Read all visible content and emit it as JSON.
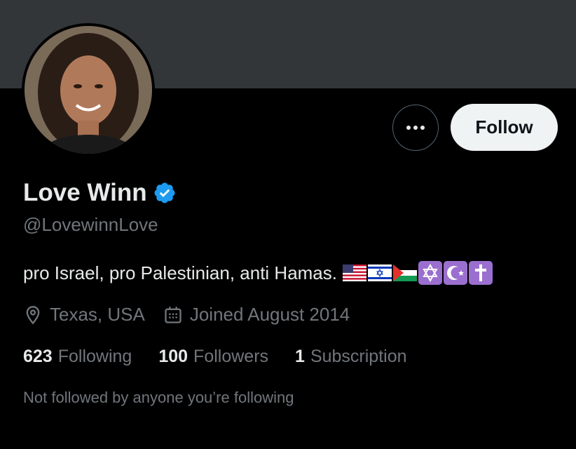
{
  "profile": {
    "display_name": "Love Winn",
    "handle": "@LovewinnLove",
    "bio": "pro Israel, pro Palestinian, anti Hamas.",
    "bio_emojis": [
      "us-flag-icon",
      "israel-flag-icon",
      "palestine-flag-icon",
      "star-of-david-icon",
      "star-and-crescent-icon",
      "latin-cross-icon"
    ],
    "location": "Texas, USA",
    "joined": "Joined August 2014",
    "verified": true
  },
  "actions": {
    "follow_label": "Follow"
  },
  "stats": {
    "following_count": "623",
    "following_label": "Following",
    "followers_count": "100",
    "followers_label": "Followers",
    "subscriptions_count": "1",
    "subscriptions_label": "Subscription"
  },
  "followed_note": "Not followed by anyone you’re following",
  "colors": {
    "background": "#000000",
    "banner": "#333639",
    "verified_blue": "#1d9bf0",
    "secondary_text": "#71767b",
    "religious_symbol_bg": "#9b6fcf"
  }
}
